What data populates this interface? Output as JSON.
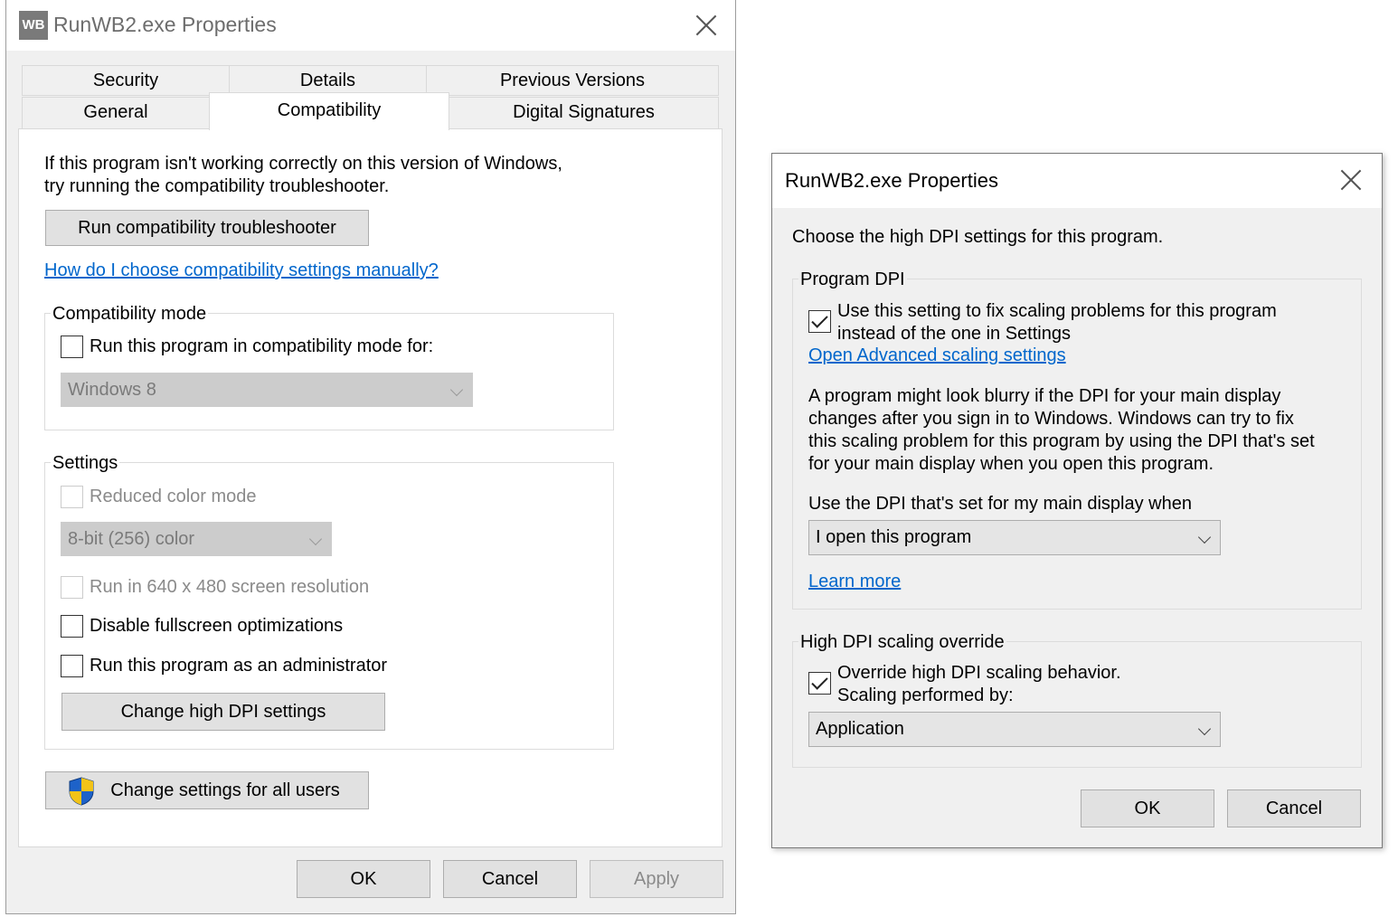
{
  "left_dialog": {
    "app_icon_text": "WB",
    "title": "RunWB2.exe Properties",
    "tabs": {
      "security": "Security",
      "details": "Details",
      "previous_versions": "Previous Versions",
      "general": "General",
      "compatibility": "Compatibility",
      "digital_signatures": "Digital Signatures"
    },
    "intro_line1": "If this program isn't working correctly on this version of Windows,",
    "intro_line2": "try running the compatibility troubleshooter.",
    "troubleshooter_button": "Run compatibility troubleshooter",
    "manual_link": "How do I choose compatibility settings manually?",
    "compat_mode": {
      "label": "Compatibility mode",
      "checkbox_label": "Run this program in compatibility mode for:",
      "checked": false,
      "select_value": "Windows 8"
    },
    "settings": {
      "label": "Settings",
      "reduced_color": "Reduced color mode",
      "color_select": "8-bit (256) color",
      "resolution_640": "Run in 640 x 480 screen resolution",
      "disable_fullscreen": "Disable fullscreen optimizations",
      "run_as_admin": "Run this program as an administrator",
      "dpi_button": "Change high DPI settings"
    },
    "all_users_button": "Change settings for all users",
    "ok": "OK",
    "cancel": "Cancel",
    "apply": "Apply"
  },
  "right_dialog": {
    "title": "RunWB2.exe Properties",
    "heading": "Choose the high DPI settings for this program.",
    "program_dpi": {
      "label": "Program DPI",
      "checkbox_line1": "Use this setting to fix scaling problems for this program",
      "checkbox_line2": "instead of the one in Settings",
      "checked": true,
      "advanced_link": "Open Advanced scaling settings",
      "desc_line1": "A program might look blurry if the DPI for your main display",
      "desc_line2": "changes after you sign in to Windows. Windows can try to fix",
      "desc_line3": "this scaling problem for this program by using the DPI that's set",
      "desc_line4": "for your main display when you open this program.",
      "when_label": "Use the DPI that's set for my main display when",
      "when_select": "I open this program",
      "learn_more": "Learn more"
    },
    "override": {
      "label": "High DPI scaling override",
      "checkbox_line1": "Override high DPI scaling behavior.",
      "checkbox_line2": "Scaling performed by:",
      "checked": true,
      "select_value": "Application"
    },
    "ok": "OK",
    "cancel": "Cancel"
  }
}
